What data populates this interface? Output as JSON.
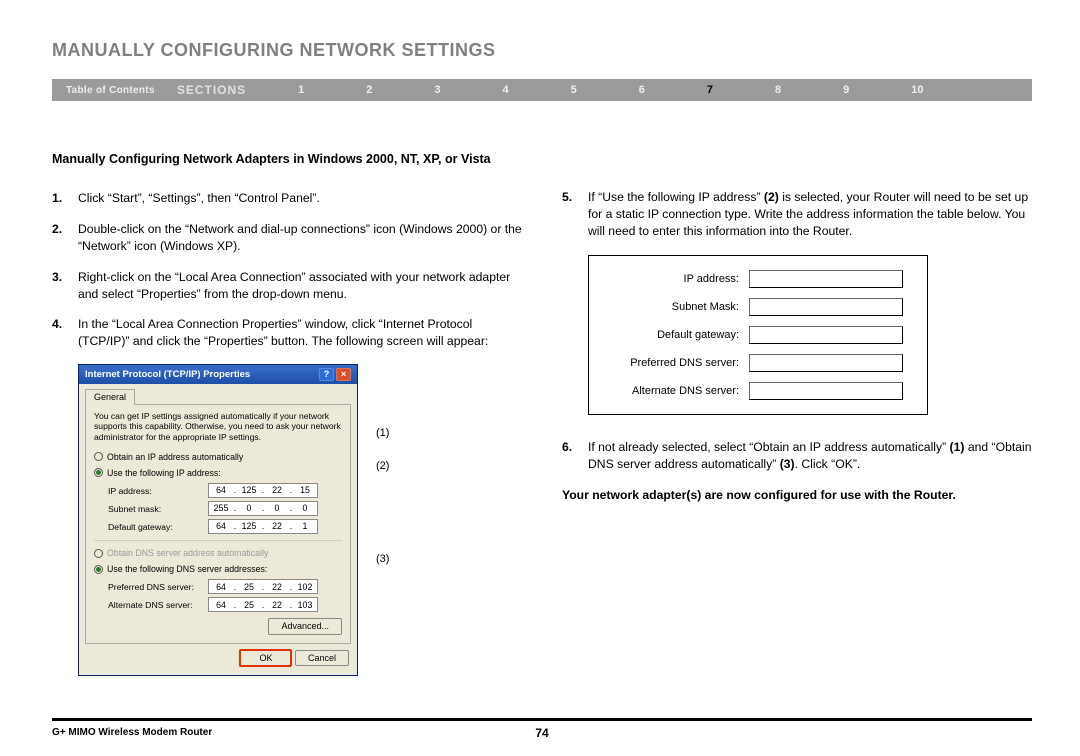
{
  "page_title": "MANUALLY CONFIGURING NETWORK SETTINGS",
  "nav": {
    "toc": "Table of Contents",
    "sections_label": "SECTIONS",
    "numbers": [
      "1",
      "2",
      "3",
      "4",
      "5",
      "6",
      "7",
      "8",
      "9",
      "10"
    ],
    "active_index": 6
  },
  "subheading": "Manually Configuring Network Adapters in Windows 2000, NT, XP, or Vista",
  "left_steps": [
    {
      "n": "1.",
      "t": "Click “Start”, “Settings”, then “Control Panel”."
    },
    {
      "n": "2.",
      "t": "Double-click on the “Network and dial-up connections” icon (Windows 2000) or the “Network” icon (Windows XP)."
    },
    {
      "n": "3.",
      "t": "Right-click on the “Local Area Connection” associated with your network adapter and select “Properties” from the drop-down menu."
    },
    {
      "n": "4.",
      "t": "In the “Local Area Connection Properties” window, click “Internet Protocol (TCP/IP)” and click the “Properties” button. The following screen will appear:"
    }
  ],
  "right_steps": [
    {
      "n": "5.",
      "t_prefix": "If “Use the following IP address” ",
      "bold1": "(2)",
      "t_mid": " is selected, your Router will need to be set up for a static IP connection type. Write the address information the table below. You will need to enter this information into the Router."
    },
    {
      "n": "6.",
      "t_prefix": "If not already selected, select “Obtain an IP address automatically” ",
      "bold1": "(1)",
      "t_mid": " and “Obtain DNS server address automatically” ",
      "bold2": "(3)",
      "t_end": ". Click “OK”."
    }
  ],
  "final_note": "Your network adapter(s) are now configured for use with the Router.",
  "dialog": {
    "title": "Internet Protocol (TCP/IP) Properties",
    "tab": "General",
    "info": "You can get IP settings assigned automatically if your network supports this capability. Otherwise, you need to ask your network administrator for the appropriate IP settings.",
    "radio_obtain_ip": "Obtain an IP address automatically",
    "radio_use_ip": "Use the following IP address:",
    "ip_label": "IP address:",
    "ip_value": [
      "64",
      "125",
      "22",
      "15"
    ],
    "subnet_label": "Subnet mask:",
    "subnet_value": [
      "255",
      "0",
      "0",
      "0"
    ],
    "gateway_label": "Default gateway:",
    "gateway_value": [
      "64",
      "125",
      "22",
      "1"
    ],
    "radio_obtain_dns": "Obtain DNS server address automatically",
    "radio_use_dns": "Use the following DNS server addresses:",
    "pref_dns_label": "Preferred DNS server:",
    "pref_dns_value": [
      "64",
      "25",
      "22",
      "102"
    ],
    "alt_dns_label": "Alternate DNS server:",
    "alt_dns_value": [
      "64",
      "25",
      "22",
      "103"
    ],
    "advanced": "Advanced...",
    "ok": "OK",
    "cancel": "Cancel"
  },
  "callouts": {
    "c1": "(1)",
    "c2": "(2)",
    "c3": "(3)"
  },
  "blank_form": {
    "ip": "IP address:",
    "subnet": "Subnet Mask:",
    "gateway": "Default gateway:",
    "pref": "Preferred DNS server:",
    "alt": "Alternate DNS server:"
  },
  "footer": {
    "product": "G+ MIMO Wireless Modem Router",
    "page_number": "74"
  }
}
